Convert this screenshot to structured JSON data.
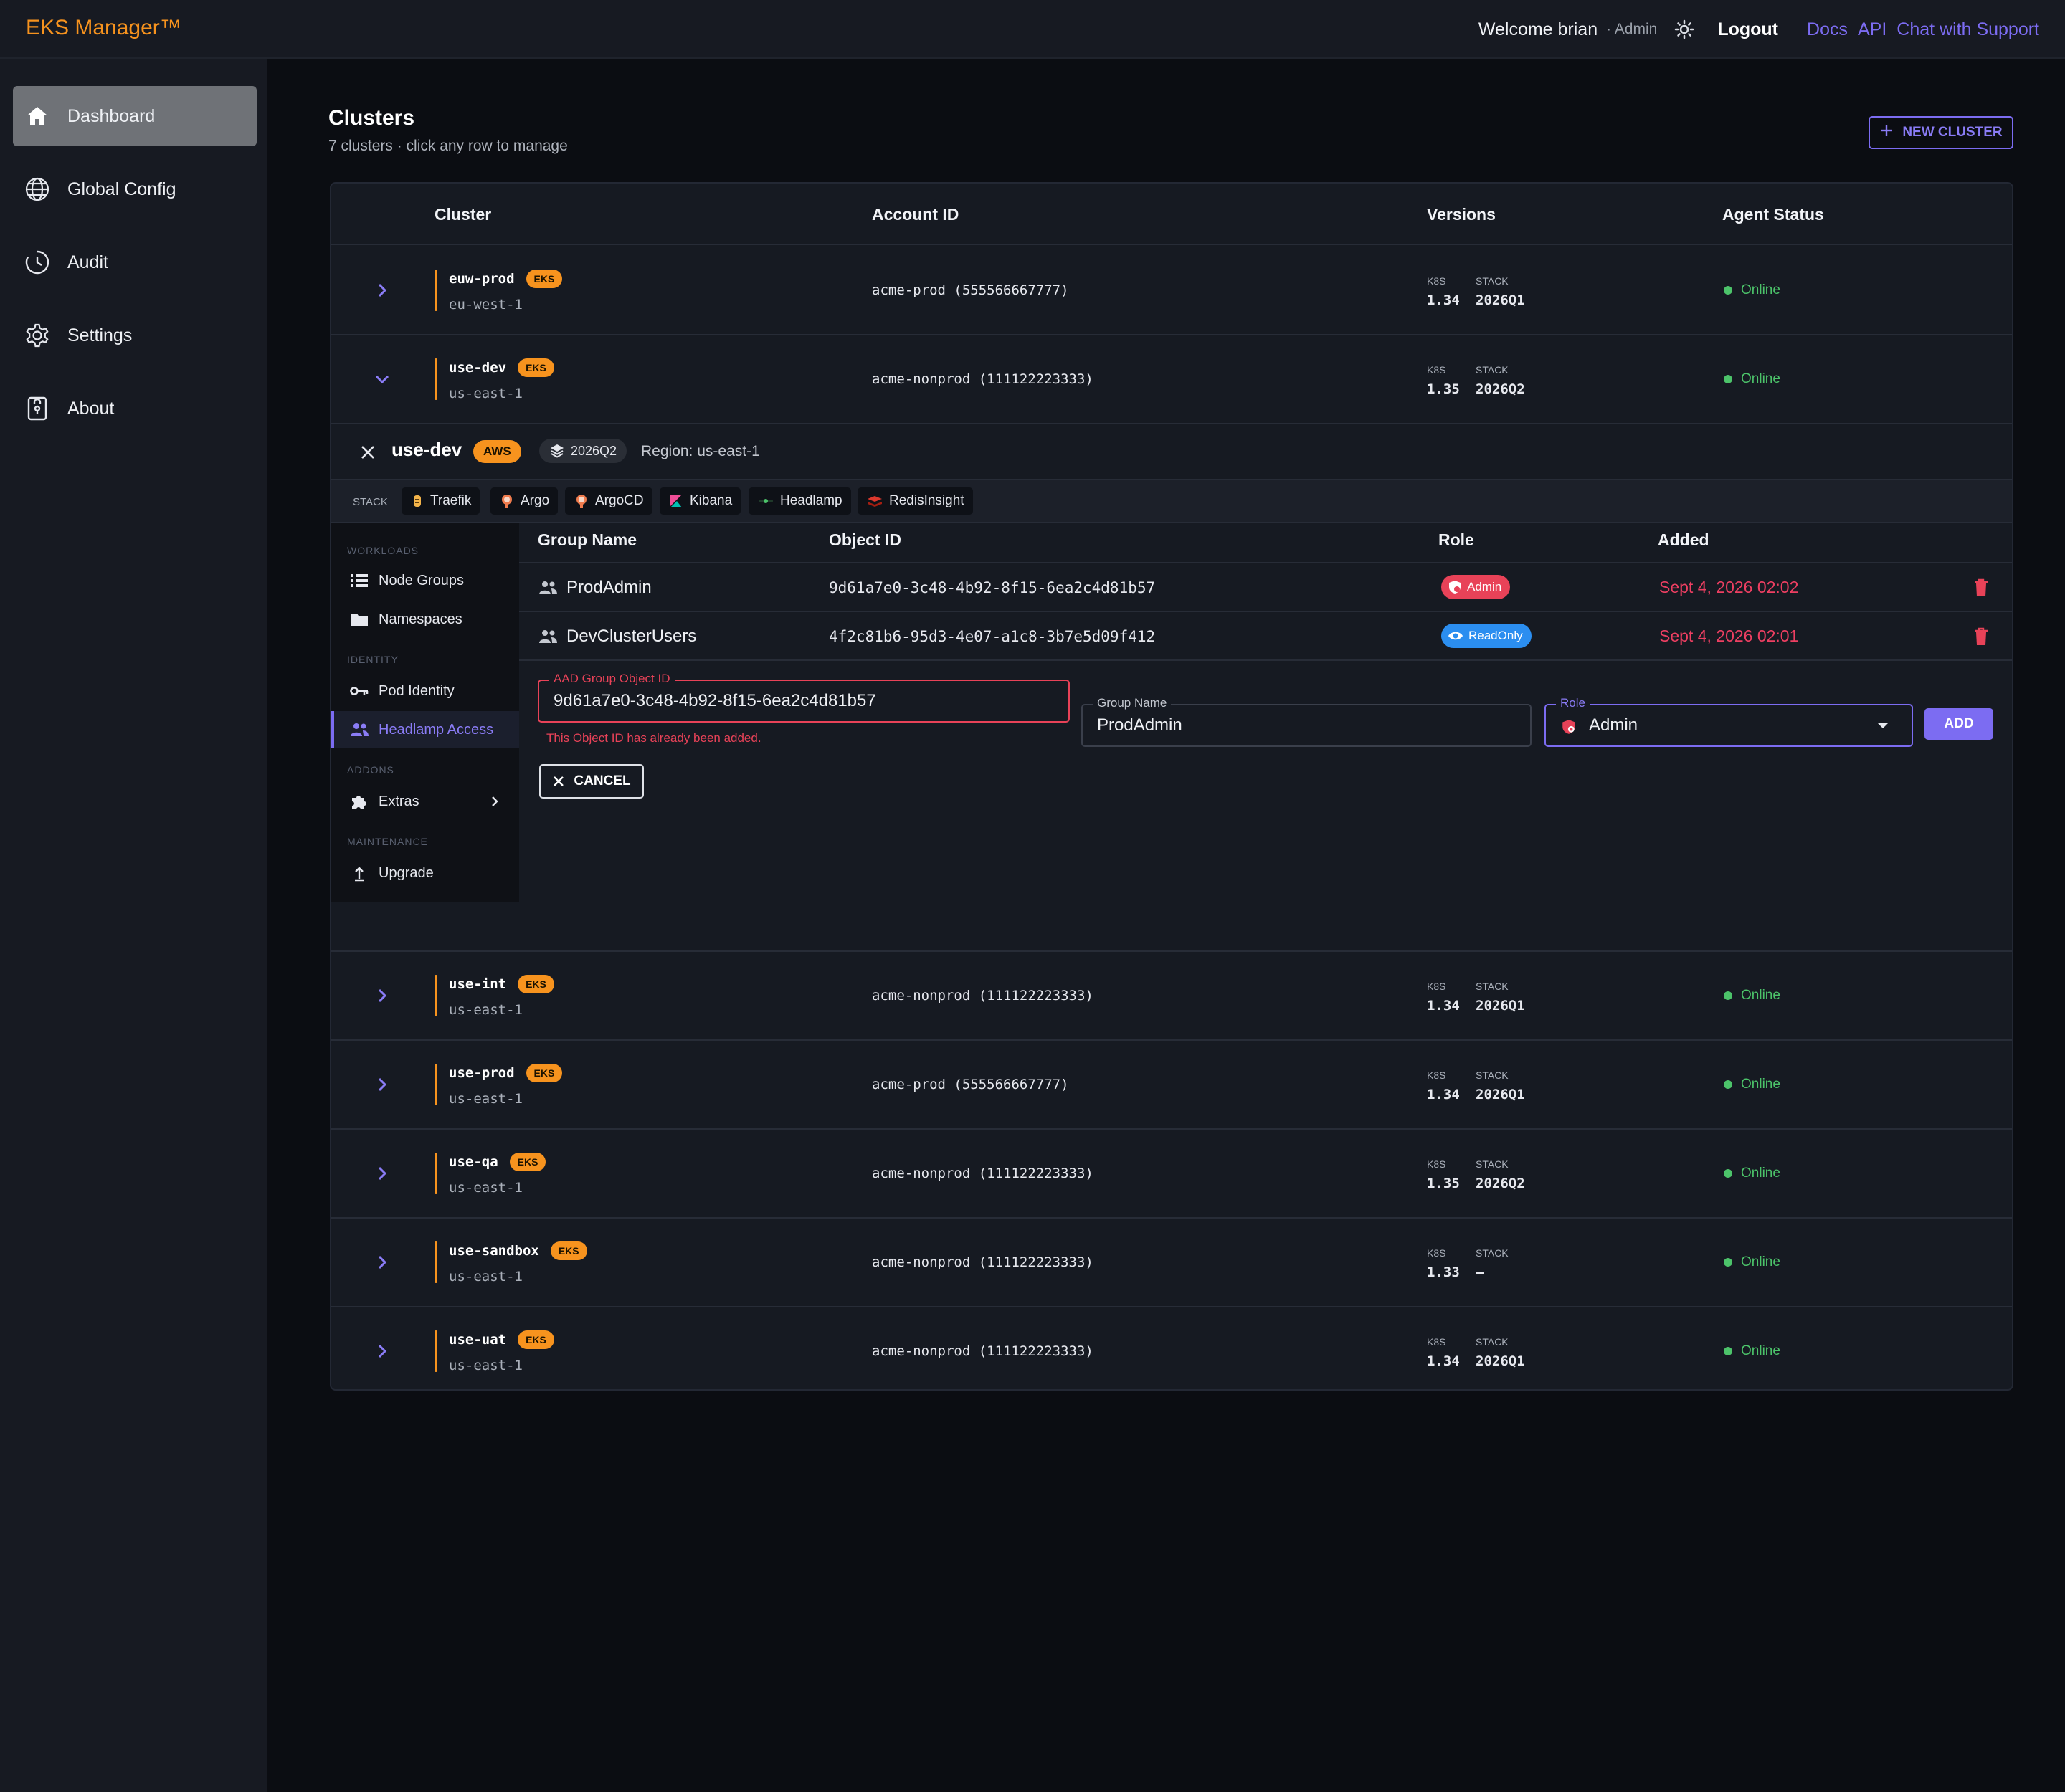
{
  "app": {
    "brand": "EKS Manager™",
    "welcome": "Welcome brian",
    "role": "· Admin",
    "logout": "Logout",
    "links": [
      "Docs",
      "API",
      "Chat with Support"
    ],
    "colors": {
      "accent": "#7c6cf2",
      "brand": "#f7931e",
      "online": "#4cc36a",
      "error": "#e84258"
    }
  },
  "sidebar": {
    "items": [
      {
        "label": "Dashboard",
        "icon": "home-icon"
      },
      {
        "label": "Global Config",
        "icon": "globe-icon"
      },
      {
        "label": "Audit",
        "icon": "clock-icon"
      },
      {
        "label": "Settings",
        "icon": "gear-icon"
      },
      {
        "label": "About",
        "icon": "lock-icon"
      }
    ]
  },
  "page": {
    "title": "Clusters",
    "subtitle": "7 clusters · click any row to manage",
    "new_cluster": "NEW CLUSTER"
  },
  "table": {
    "headers": {
      "cluster": "Cluster",
      "account": "Account ID",
      "versions": "Versions",
      "status": "Agent Status"
    },
    "k8s_label": "K8S",
    "stack_label": "STACK",
    "rows": [
      {
        "name": "euw-prod",
        "badge": "EKS",
        "region": "eu-west-1",
        "account": "acme-prod (555566667777)",
        "k8s": "1.34",
        "stack": "2026Q1",
        "status": "Online"
      },
      {
        "name": "use-dev",
        "badge": "EKS",
        "region": "us-east-1",
        "account": "acme-nonprod (111122223333)",
        "k8s": "1.35",
        "stack": "2026Q2",
        "status": "Online"
      },
      {
        "name": "use-int",
        "badge": "EKS",
        "region": "us-east-1",
        "account": "acme-nonprod (111122223333)",
        "k8s": "1.34",
        "stack": "2026Q1",
        "status": "Online"
      },
      {
        "name": "use-prod",
        "badge": "EKS",
        "region": "us-east-1",
        "account": "acme-prod (555566667777)",
        "k8s": "1.34",
        "stack": "2026Q1",
        "status": "Online"
      },
      {
        "name": "use-qa",
        "badge": "EKS",
        "region": "us-east-1",
        "account": "acme-nonprod (111122223333)",
        "k8s": "1.35",
        "stack": "2026Q2",
        "status": "Online"
      },
      {
        "name": "use-sandbox",
        "badge": "EKS",
        "region": "us-east-1",
        "account": "acme-nonprod (111122223333)",
        "k8s": "1.33",
        "stack": "–",
        "status": "Online"
      },
      {
        "name": "use-uat",
        "badge": "EKS",
        "region": "us-east-1",
        "account": "acme-nonprod (111122223333)",
        "k8s": "1.34",
        "stack": "2026Q1",
        "status": "Online"
      }
    ]
  },
  "panel": {
    "title": "use-dev",
    "provider": "AWS",
    "version": "2026Q2",
    "region": "Region: us-east-1",
    "stack_label": "STACK",
    "stack": [
      {
        "name": "Traefik",
        "icon": "traefik-icon"
      },
      {
        "name": "Argo",
        "icon": "argo-icon"
      },
      {
        "name": "ArgoCD",
        "icon": "argocd-icon"
      },
      {
        "name": "Kibana",
        "icon": "kibana-icon"
      },
      {
        "name": "Headlamp",
        "icon": "headlamp-icon"
      },
      {
        "name": "RedisInsight",
        "icon": "redis-icon"
      }
    ],
    "nav": {
      "groups": [
        "WORKLOADS",
        "IDENTITY",
        "ADDONS",
        "MAINTENANCE"
      ],
      "items": [
        "Node Groups",
        "Namespaces",
        "Pod Identity",
        "Headlamp Access",
        "Extras",
        "Upgrade"
      ]
    },
    "access": {
      "headers": [
        "Group Name",
        "Object ID",
        "Role",
        "Added"
      ],
      "rows": [
        {
          "group": "ProdAdmin",
          "oid": "9d61a7e0-3c48-4b92-8f15-6ea2c4d81b57",
          "role": "Admin",
          "added": "Sept 4, 2026 02:02"
        },
        {
          "group": "DevClusterUsers",
          "oid": "4f2c81b6-95d3-4e07-a1c8-3b7e5d09f412",
          "role": "ReadOnly",
          "added": "Sept 4, 2026 02:01"
        }
      ]
    },
    "form": {
      "oid_label": "AAD Group Object ID",
      "oid_value": "9d61a7e0-3c48-4b92-8f15-6ea2c4d81b57",
      "oid_error": "This Object ID has already been added.",
      "group_label": "Group Name",
      "group_value": "ProdAdmin",
      "role_label": "Role",
      "role_value": "Admin",
      "add": "ADD",
      "cancel": "CANCEL"
    }
  }
}
